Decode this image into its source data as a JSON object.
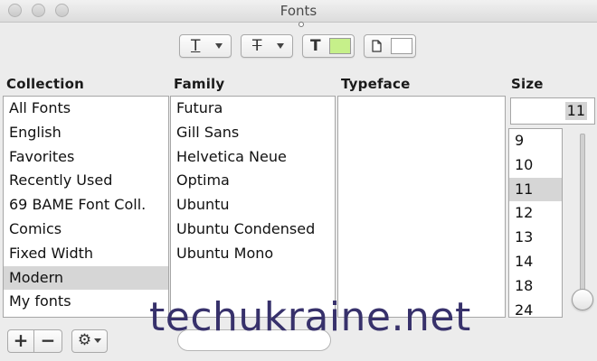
{
  "window": {
    "title": "Fonts"
  },
  "toolbar": {
    "underline_glyph": "T",
    "strikethrough_glyph": "T",
    "text_color_glyph": "T",
    "text_color": "#c6f08a",
    "document_color": "#ffffff"
  },
  "collection": {
    "header": "Collection",
    "items": [
      "All Fonts",
      "English",
      "Favorites",
      "Recently Used",
      "69 BAME Font Coll.",
      "Comics",
      "Fixed Width",
      "Modern",
      "My fonts"
    ],
    "selected": "Modern"
  },
  "family": {
    "header": "Family",
    "items": [
      "Futura",
      "Gill Sans",
      "Helvetica Neue",
      "Optima",
      "Ubuntu",
      "Ubuntu Condensed",
      "Ubuntu Mono"
    ]
  },
  "typeface": {
    "header": "Typeface",
    "items": []
  },
  "size": {
    "header": "Size",
    "value": "11",
    "items": [
      "9",
      "10",
      "11",
      "12",
      "13",
      "14",
      "18",
      "24"
    ],
    "selected": "11"
  },
  "bottom": {
    "add_label": "+",
    "remove_label": "−",
    "actions_glyph": "⚙"
  },
  "watermark": "techukraine.net"
}
